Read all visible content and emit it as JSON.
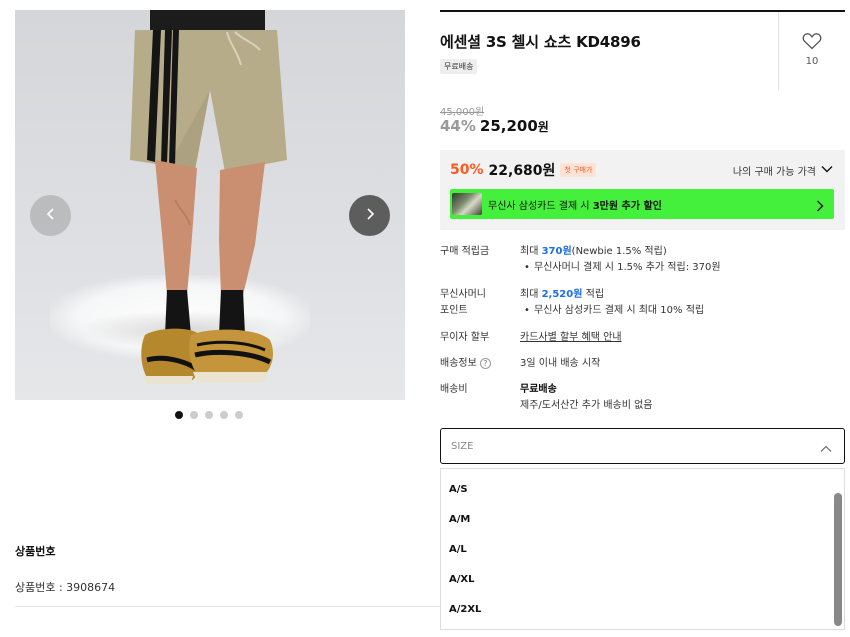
{
  "gallery": {
    "slide_count": 5,
    "active_index": 0
  },
  "product": {
    "title": "에센셜 3S 첼시 쇼츠 KD4896",
    "shipping_badge": "무료배송",
    "like_count": "10",
    "original_price": "45,000원",
    "discount_rate": "44%",
    "sale_price": "25,200",
    "sale_price_unit": "원"
  },
  "my_price": {
    "rate": "50%",
    "price": "22,680원",
    "badge": "첫 구매가",
    "toggle_label": "나의 구매 가능 가격"
  },
  "banner": {
    "text_prefix": "무신사 삼성카드 결제 시 ",
    "text_bold": "3만원 추가 할인"
  },
  "info": {
    "points_label": "구매 적립금",
    "points_value_prefix": "최대 ",
    "points_value_amount": "370원",
    "points_value_suffix": "(Newbie 1.5% 적립)",
    "points_sub": "무신사머니 결제 시 1.5% 추가 적립: 370원",
    "money_label_1": "무신사머니",
    "money_label_2": "포인트",
    "money_value_prefix": "최대 ",
    "money_value_amount": "2,520원",
    "money_value_suffix": " 적립",
    "money_sub": "무신사 삼성카드 결제 시 최대 10% 적립",
    "installment_label": "무이자 할부",
    "installment_link": "카드사별 할부 혜택 안내",
    "delivery_label": "배송정보",
    "delivery_value": "3일 이내 배송 시작",
    "shipping_label": "배송비",
    "shipping_value": "무료배송",
    "shipping_sub": "제주/도서산간 추가 배송비 없음"
  },
  "size_select": {
    "placeholder": "SIZE",
    "options": [
      "A/S",
      "A/M",
      "A/L",
      "A/XL",
      "A/2XL"
    ]
  },
  "product_number": {
    "title": "상품번호",
    "value": "상품번호 : 3908674"
  },
  "colors": {
    "accent_orange": "#ff5a1f",
    "point_blue": "#1f6fe0",
    "banner_green": "#45f03c"
  },
  "icons": {
    "like": "heart-outline-icon",
    "prev": "chevron-left-icon",
    "next": "chevron-right-icon",
    "dropdown": "chevron-up-icon",
    "help": "question-circle-icon"
  }
}
